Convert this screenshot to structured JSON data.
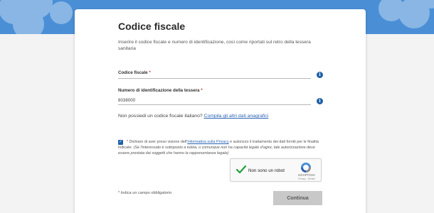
{
  "colors": {
    "header_bg": "#4a8fd6",
    "page_bg": "#f3f3f3",
    "accent": "#1f5fa8",
    "link": "#2a64b3",
    "required": "#d0302f",
    "button_disabled": "#c8c8c8"
  },
  "form": {
    "title": "Codice fiscale",
    "intro": "Inserire il codice fiscale e numero di identificazione, così come riportati sul retro della tessera sanitaria",
    "fiscal_code": {
      "label": "Codice fiscale",
      "required_mark": "*",
      "value": "",
      "icon": "info-icon"
    },
    "card_number": {
      "label": "Numero di identificazione della tessera",
      "required_mark": "*",
      "value": "8038000",
      "icon": "info-icon"
    },
    "no_fiscal_code": {
      "text": "Non possiedi un codice fiscale italiano?",
      "link": "Compila gli altri dati anagrafici"
    },
    "consent": {
      "checked": true,
      "required_mark": "*",
      "text_before": "Dichiaro di aver preso visione dell'",
      "link": "Informativa sulla Privacy",
      "text_after": " e autorizzo il trattamento dei dati forniti per le finalità indicate.",
      "note": "(Se l'interessato è sottoposto a tutela, o comunque non ha capacità legale d'agire, tale autorizzazione deve essere prestata dai soggetti che hanno la rappresentanza legale)"
    },
    "recaptcha": {
      "label": "Non sono un robot",
      "brand": "reCAPTCHA",
      "links": "Privacy - Termini",
      "checked": true
    },
    "required_note": "* Indica un campo obbligatorio",
    "submit_label": "Continua"
  }
}
